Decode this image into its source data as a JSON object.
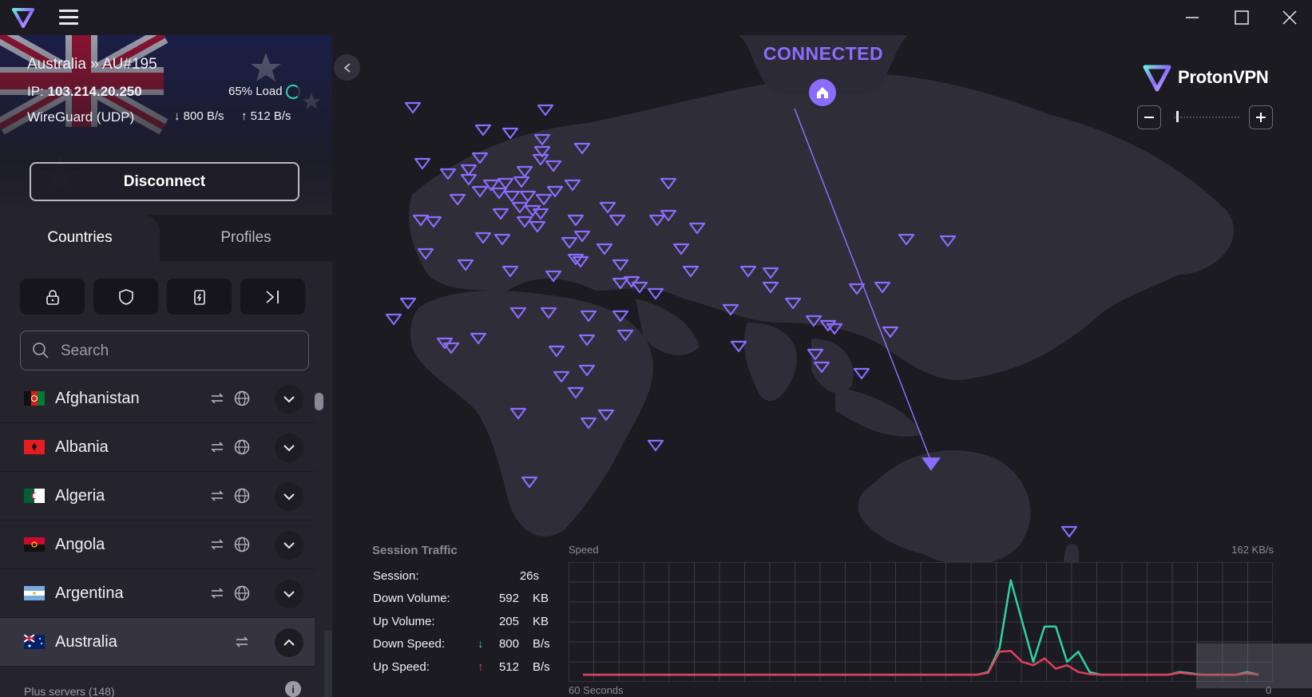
{
  "app": {
    "name": "ProtonVPN",
    "brand_color": "#8a6cff"
  },
  "connection": {
    "server": "Australia » AU#195",
    "ip_label": "IP:",
    "ip": "103.214.20.250",
    "load": "65% Load",
    "protocol": "WireGuard (UDP)",
    "down": "800 B/s",
    "up": "512 B/s",
    "disconnect_label": "Disconnect",
    "status": "CONNECTED"
  },
  "tabs": [
    {
      "label": "Countries",
      "active": true
    },
    {
      "label": "Profiles",
      "active": false
    }
  ],
  "filters": [
    "lock-icon",
    "shield-icon",
    "secure-core-icon",
    "split-tunnel-icon"
  ],
  "search": {
    "placeholder": "Search"
  },
  "countries": [
    {
      "name": "Afghanistan",
      "expanded": false
    },
    {
      "name": "Albania",
      "expanded": false
    },
    {
      "name": "Algeria",
      "expanded": false
    },
    {
      "name": "Angola",
      "expanded": false
    },
    {
      "name": "Argentina",
      "expanded": false
    },
    {
      "name": "Australia",
      "expanded": true
    }
  ],
  "plus_servers": "Plus servers (148)",
  "traffic": {
    "title": "Session Traffic",
    "session_label": "Session:",
    "session_value": "26s",
    "down_volume_label": "Down Volume:",
    "down_volume_value": "592",
    "down_volume_unit": "KB",
    "up_volume_label": "Up Volume:",
    "up_volume_value": "205",
    "up_volume_unit": "KB",
    "down_speed_label": "Down Speed:",
    "down_speed_value": "800",
    "down_speed_unit": "B/s",
    "up_speed_label": "Up Speed:",
    "up_speed_value": "512",
    "up_speed_unit": "B/s",
    "chart_speed_label": "Speed",
    "chart_max_label": "162  KB/s",
    "chart_x_label": "60 Seconds",
    "chart_zero_label": "0",
    "down_color": "#2fd4a0",
    "up_color": "#e0405a"
  },
  "chart_data": {
    "type": "line",
    "x": [
      0,
      1,
      2,
      3,
      4,
      5,
      6,
      7,
      8,
      9,
      10,
      11,
      12,
      13,
      14,
      15,
      16,
      17,
      18,
      19,
      20,
      21,
      22,
      23,
      24,
      25,
      26,
      27,
      28,
      29,
      30,
      31,
      32,
      33,
      34,
      35,
      36,
      37,
      38,
      39,
      40,
      41,
      42,
      43,
      44,
      45,
      46,
      47,
      48,
      49,
      50,
      51,
      52,
      53,
      54,
      55,
      56,
      57,
      58,
      59,
      60
    ],
    "ylim": [
      0,
      162
    ],
    "series": [
      {
        "values": [
          1,
          1,
          1,
          1,
          1,
          1,
          1,
          1,
          1,
          1,
          1,
          1,
          1,
          1,
          1,
          1,
          1,
          1,
          1,
          1,
          1,
          1,
          1,
          1,
          1,
          1,
          1,
          1,
          1,
          1,
          1,
          1,
          1,
          1,
          1,
          1,
          5,
          40,
          140,
          80,
          20,
          72,
          72,
          20,
          35,
          5,
          1,
          1,
          1,
          1,
          1,
          1,
          1,
          5,
          3,
          1,
          1,
          1,
          1,
          5,
          1
        ]
      },
      {
        "values": [
          1,
          1,
          1,
          1,
          1,
          1,
          1,
          1,
          1,
          1,
          1,
          1,
          1,
          1,
          1,
          1,
          1,
          1,
          1,
          1,
          1,
          1,
          1,
          1,
          1,
          1,
          1,
          1,
          1,
          1,
          1,
          1,
          1,
          1,
          1,
          1,
          4,
          35,
          36,
          20,
          15,
          25,
          10,
          15,
          5,
          2,
          1,
          1,
          1,
          1,
          1,
          1,
          1,
          4,
          2,
          1,
          1,
          1,
          1,
          3,
          1
        ]
      }
    ]
  }
}
